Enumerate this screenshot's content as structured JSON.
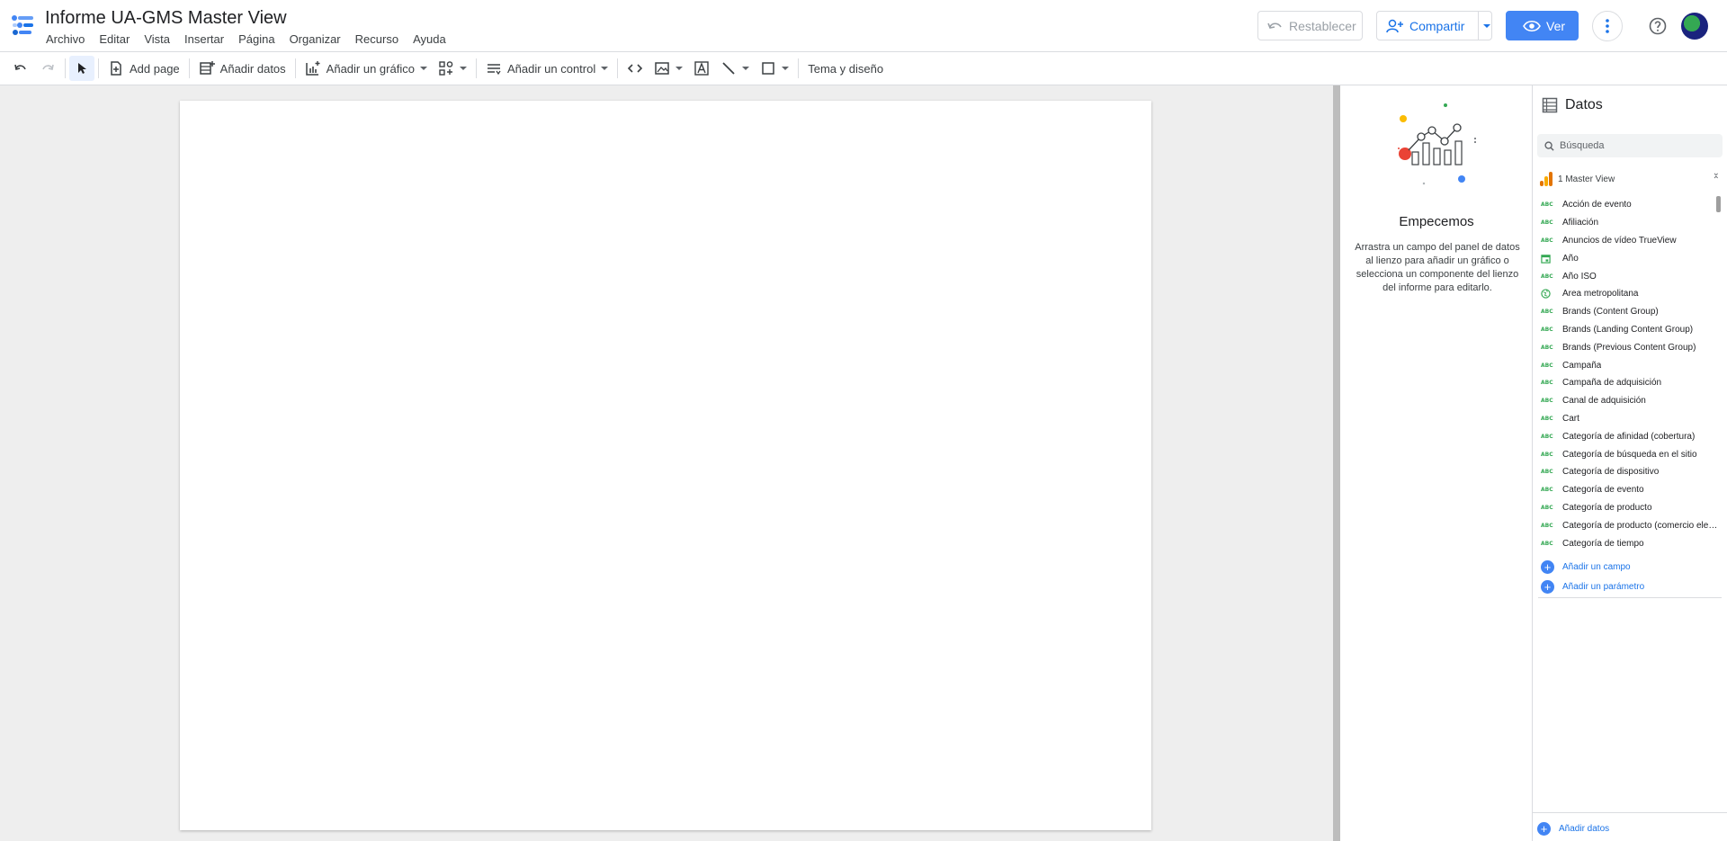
{
  "header": {
    "title": "Informe UA-GMS Master View",
    "menu": [
      "Archivo",
      "Editar",
      "Vista",
      "Insertar",
      "Página",
      "Organizar",
      "Recurso",
      "Ayuda"
    ],
    "restablecer_label": "Restablecer",
    "compartir_label": "Compartir",
    "ver_label": "Ver"
  },
  "toolbar": {
    "add_page_label": "Add page",
    "add_data_label": "Añadir datos",
    "add_chart_label": "Añadir un gráfico",
    "add_control_label": "Añadir un control",
    "theme_label": "Tema y diseño"
  },
  "properties_panel": {
    "title": "Empecemos",
    "description": "Arrastra un campo del panel de datos al lienzo para añadir un gráfico o selecciona un componente del lienzo del informe para editarlo."
  },
  "data_panel": {
    "title": "Datos",
    "search_placeholder": "Búsqueda",
    "source_name": "1 Master View",
    "fields": [
      {
        "type": "text",
        "name": "Acción de evento"
      },
      {
        "type": "text",
        "name": "Afiliación"
      },
      {
        "type": "text",
        "name": "Anuncios de vídeo TrueView"
      },
      {
        "type": "date",
        "name": "Año"
      },
      {
        "type": "text",
        "name": "Año ISO"
      },
      {
        "type": "geo",
        "name": "Área metropolitana"
      },
      {
        "type": "text",
        "name": "Brands (Content Group)"
      },
      {
        "type": "text",
        "name": "Brands (Landing Content Group)"
      },
      {
        "type": "text",
        "name": "Brands (Previous Content Group)"
      },
      {
        "type": "text",
        "name": "Campaña"
      },
      {
        "type": "text",
        "name": "Campaña de adquisición"
      },
      {
        "type": "text",
        "name": "Canal de adquisición"
      },
      {
        "type": "text",
        "name": "Cart"
      },
      {
        "type": "text",
        "name": "Categoría de afinidad (cobertura)"
      },
      {
        "type": "text",
        "name": "Categoría de búsqueda en el sitio"
      },
      {
        "type": "text",
        "name": "Categoría de dispositivo"
      },
      {
        "type": "text",
        "name": "Categoría de evento"
      },
      {
        "type": "text",
        "name": "Categoría de producto"
      },
      {
        "type": "text",
        "name": "Categoría de producto (comercio electrónico mejorado)"
      },
      {
        "type": "text",
        "name": "Categoría de tiempo"
      }
    ],
    "type_text_badge": "ABC",
    "add_field_label": "Añadir un campo",
    "add_param_label": "Añadir un parámetro",
    "add_data_label": "Añadir datos"
  },
  "colors": {
    "primary": "#1a73e8",
    "button_blue": "#4285f4",
    "field_type": "#34a853",
    "canvas_bg": "#eeeeee"
  }
}
